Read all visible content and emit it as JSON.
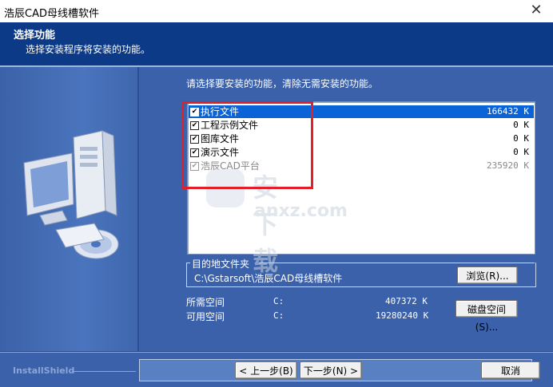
{
  "window": {
    "title": "浩辰CAD母线槽软件",
    "close_glyph": "✕"
  },
  "header": {
    "title": "选择功能",
    "subtitle": "选择安装程序将安装的功能。"
  },
  "main": {
    "instruction": "请选择要安装的功能，清除无需安装的功能。",
    "features": [
      {
        "name": "执行文件",
        "size": "166432 K",
        "checked": true,
        "selected": true,
        "disabled": false
      },
      {
        "name": "工程示例文件",
        "size": "0 K",
        "checked": true,
        "selected": false,
        "disabled": false
      },
      {
        "name": "图库文件",
        "size": "0 K",
        "checked": true,
        "selected": false,
        "disabled": false
      },
      {
        "name": "演示文件",
        "size": "0 K",
        "checked": true,
        "selected": false,
        "disabled": false
      },
      {
        "name": "浩辰CAD平台",
        "size": "235920 K",
        "checked": true,
        "selected": false,
        "disabled": true
      }
    ],
    "check_glyph": "✔",
    "dest_group_label": "目的地文件夹",
    "dest_path": "C:\\Gstarsoft\\浩辰CAD母线槽软件",
    "browse_button": "浏览(R)...",
    "required_label": "所需空间",
    "required_drive": "C:",
    "required_value": "407372 K",
    "available_label": "可用空间",
    "available_drive": "C:",
    "available_value": "19280240 K",
    "disk_space_button": "磁盘空间(S)..."
  },
  "watermark": {
    "text_cn": "安下载",
    "text_en": "anxz.com"
  },
  "footer": {
    "brand": "InstallShield",
    "back_button": "< 上一步(B)",
    "next_button": "下一步(N) >",
    "cancel_button": "取消"
  },
  "colors": {
    "background": "#3a61a9",
    "header": "#0d3a86",
    "selection": "#0a64d8",
    "highlight_box": "#e2202a"
  }
}
